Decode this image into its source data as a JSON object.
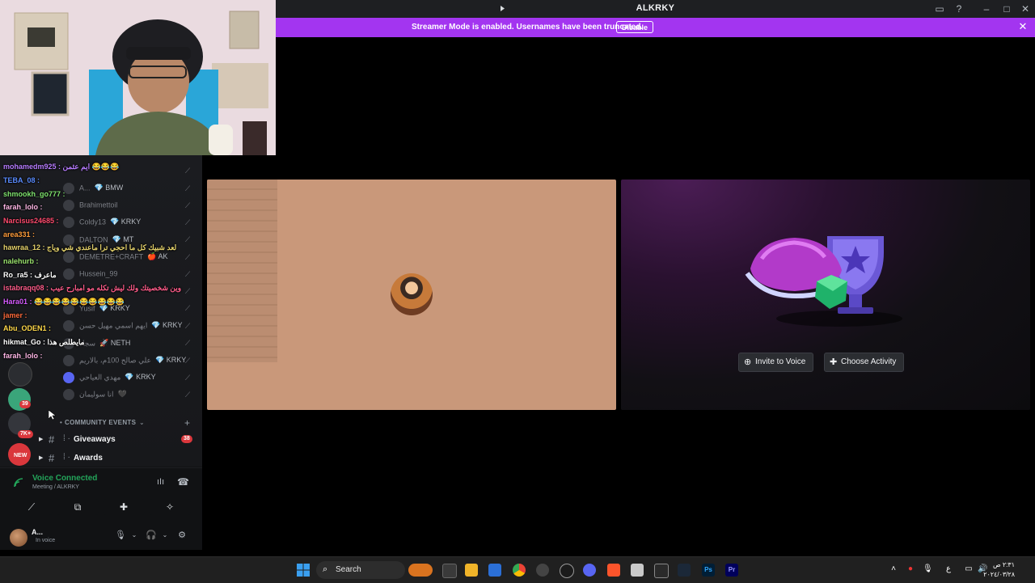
{
  "window": {
    "title": "ALKRKY"
  },
  "banner": {
    "text": "Streamer Mode is enabled. Usernames have been truncated.",
    "button": "Disable",
    "color": "#a335f0"
  },
  "chat_overlay": [
    {
      "text": "mohamedm925 : ايم عثمن 😂😂😂",
      "color": "#b77cff"
    },
    {
      "text": "TEBA_08 :",
      "color": "#5a8cff"
    },
    {
      "text": "shmookh_go777 :",
      "color": "#7fe36e"
    },
    {
      "text": "farah_lolo :",
      "color": "#ffb7e6"
    },
    {
      "text": "Narcisus24685 :",
      "color": "#ff4b6e"
    },
    {
      "text": "area331 :",
      "color": "#ff9c3a"
    },
    {
      "text": "hawraa_12 : لعد شبيك كل ما احجي ترا ماعندي شي وياج",
      "color": "#e6d36b"
    },
    {
      "text": "nalehurb :",
      "color": "#9be36e"
    },
    {
      "text": "Ro_ra5 : ماعرف",
      "color": "#ffffff"
    },
    {
      "text": "istabraqq08 : وين شخصيتك ولك ليش تكله مو امبارح عيب",
      "color": "#ff5c8a"
    },
    {
      "text": "Hara01 : 😂😂😂😂😂😂😂😂😂😂",
      "color": "#d65cff"
    },
    {
      "text": "jamer :",
      "color": "#ff6a3a"
    },
    {
      "text": "Abu_ODEN1 :",
      "color": "#ffd94a"
    },
    {
      "text": "hikmat_Go : مايطلص هذا",
      "color": "#ffffff"
    },
    {
      "text": "farah_lolo :",
      "color": "#ffb7e6"
    }
  ],
  "members": [
    {
      "name": "A...",
      "tag": "💎 BMW"
    },
    {
      "name": "Brahimettoil",
      "tag": ""
    },
    {
      "name": "Coldy13",
      "tag": "💎 KRKY"
    },
    {
      "name": "DALTON",
      "tag": "💎 MT"
    },
    {
      "name": "DEMETRE+CRAFT",
      "tag": "🍎 AK"
    },
    {
      "name": "Hussein_99",
      "tag": ""
    },
    {
      "name": "Yusif",
      "tag": "💎 KRKY"
    },
    {
      "name": "ايهم اسمي مهيل حسن",
      "tag": "💎 KRKY"
    },
    {
      "name": "سجاد",
      "tag": "🚀 NETH"
    },
    {
      "name": "علي صالح 100م، بالاريم",
      "tag": "💎 KRKY"
    },
    {
      "name": "مهدي العياحي",
      "tag": "💎 KRKY"
    },
    {
      "name": "انا سوليمان",
      "tag": "🖤"
    }
  ],
  "server_badges": {
    "first": "39",
    "second": "7K+",
    "third": "NEW"
  },
  "category": {
    "label": "COMMUNITY EVENTS",
    "add": "+"
  },
  "channels": [
    {
      "name": "Giveaways",
      "badge": "38"
    },
    {
      "name": "Awards",
      "badge": ""
    }
  ],
  "voice": {
    "status": "Voice Connected",
    "location": "Meeting / ALKRKY"
  },
  "user": {
    "name": "A...",
    "status": "In voice"
  },
  "activity": {
    "invite": "Invite to Voice",
    "choose": "Choose Activity"
  },
  "taskbar": {
    "search_label": "Search",
    "time": "٢:٣١ ص",
    "date": "٢٠٢٤/٠٣/٢٨",
    "lang": "ع"
  }
}
